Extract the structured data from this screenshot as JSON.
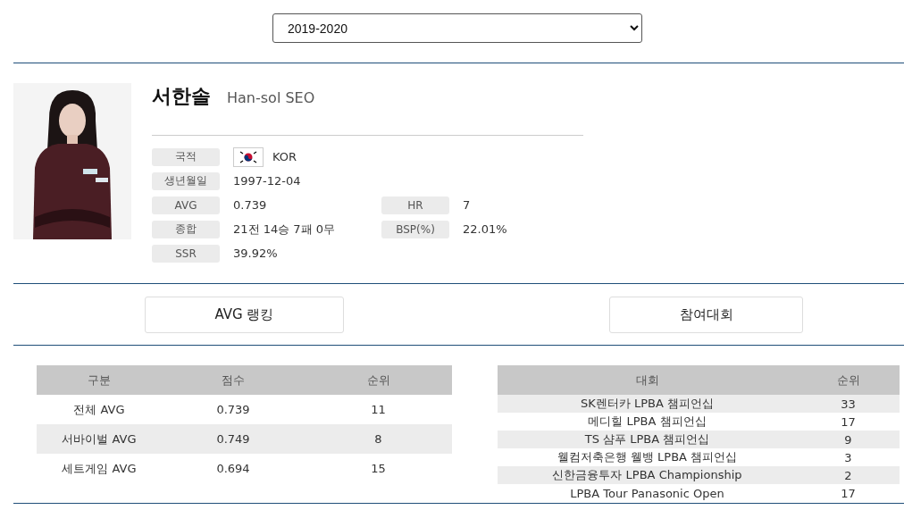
{
  "season_select": {
    "value": "2019-2020"
  },
  "player": {
    "name_korean": "서한솔",
    "name_english": "Han-sol SEO",
    "info": [
      {
        "label": "국적",
        "value": "KOR",
        "kind": "flag"
      },
      {
        "label": "생년월일",
        "value": "1997-12-04",
        "kind": "text"
      },
      {
        "label": "AVG",
        "value": "0.739",
        "kind": "text",
        "label_2": "HR",
        "value_2": "7"
      },
      {
        "label": "종합",
        "value": "21전 14승 7패 0무",
        "kind": "text",
        "label_2": "BSP(%)",
        "value_2": "22.01%"
      },
      {
        "label": "SSR",
        "value": "39.92%",
        "kind": "text"
      }
    ]
  },
  "buttons": [
    "AVG 랭킹",
    "참여대회"
  ],
  "avg_table": {
    "columns": [
      "구분",
      "점수",
      "순위"
    ],
    "rows": [
      [
        "전체 AVG",
        "0.739",
        "11"
      ],
      [
        "서바이벌 AVG",
        "0.749",
        "8"
      ],
      [
        "세트게임 AVG",
        "0.694",
        "15"
      ]
    ]
  },
  "tournament_table": {
    "columns": [
      "대회",
      "순위"
    ],
    "rows": [
      [
        "SK렌터카 LPBA 챔피언십",
        "33"
      ],
      [
        "메디힐 LPBA 챔피언십",
        "17"
      ],
      [
        "TS 샴푸 LPBA 챔피언십",
        "9"
      ],
      [
        "웰컴저축은행 웰뱅 LPBA 챔피언십",
        "3"
      ],
      [
        "신한금융투자 LPBA Championship",
        "2"
      ],
      [
        "LPBA Tour Panasonic Open",
        "17"
      ]
    ]
  }
}
